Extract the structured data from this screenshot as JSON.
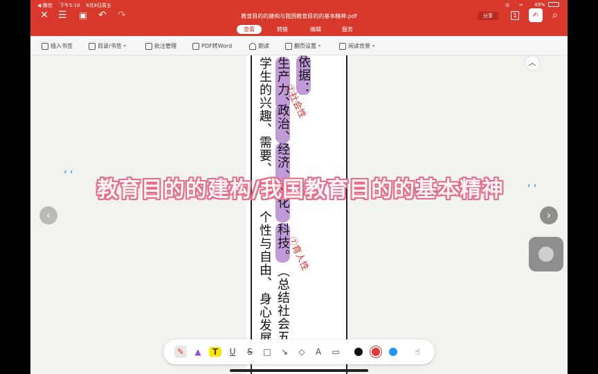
{
  "status": {
    "app_back": "◀ 微信",
    "time": "下午5:10",
    "date": "9月9日周五",
    "battery": "49%"
  },
  "header": {
    "title": "教育目的的建构与我国教育目的的基本精神.pdf",
    "share_label": "分享",
    "page_badge": "1",
    "tabs": [
      {
        "label": "查看",
        "active": true
      },
      {
        "label": "转换",
        "active": false
      },
      {
        "label": "编辑",
        "active": false
      },
      {
        "label": "服务",
        "active": false
      }
    ]
  },
  "toolbar": {
    "items": [
      {
        "label": "插入书签",
        "icon": "bookmark-icon",
        "has_menu": false
      },
      {
        "label": "目录/书签",
        "icon": "toc-icon",
        "has_menu": true
      },
      {
        "label": "批注管理",
        "icon": "annotation-icon",
        "has_menu": false
      },
      {
        "label": "PDF转Word",
        "icon": "pdf-icon",
        "has_menu": false
      },
      {
        "label": "朗读",
        "icon": "headphone-icon",
        "has_menu": false
      },
      {
        "label": "翻页设置",
        "icon": "page-icon",
        "has_menu": true
      },
      {
        "label": "阅读背景",
        "icon": "background-icon",
        "has_menu": true
      }
    ]
  },
  "document": {
    "columns": [
      "依据：",
      "生产力、",
      "学生的兴趣、需要、",
      "政治、",
      "经济、",
      "文化、",
      "科技。",
      "个性与自由、",
      "（总结社会五",
      "身心发展"
    ],
    "handwriting": [
      "⑦社会性",
      "⑦育人性"
    ]
  },
  "overlay": {
    "title": "教育目的的建构/我国教育目的的基本精神"
  },
  "pen_toolbar": {
    "tools": [
      "pen-icon",
      "marker-icon",
      "highlight-icon",
      "underline-icon",
      "strikethrough-icon",
      "rectangle-icon",
      "arrow-icon",
      "eraser-icon",
      "text-icon",
      "comment-icon"
    ],
    "colors": [
      "#111111",
      "#e53935",
      "#2196f3"
    ]
  }
}
